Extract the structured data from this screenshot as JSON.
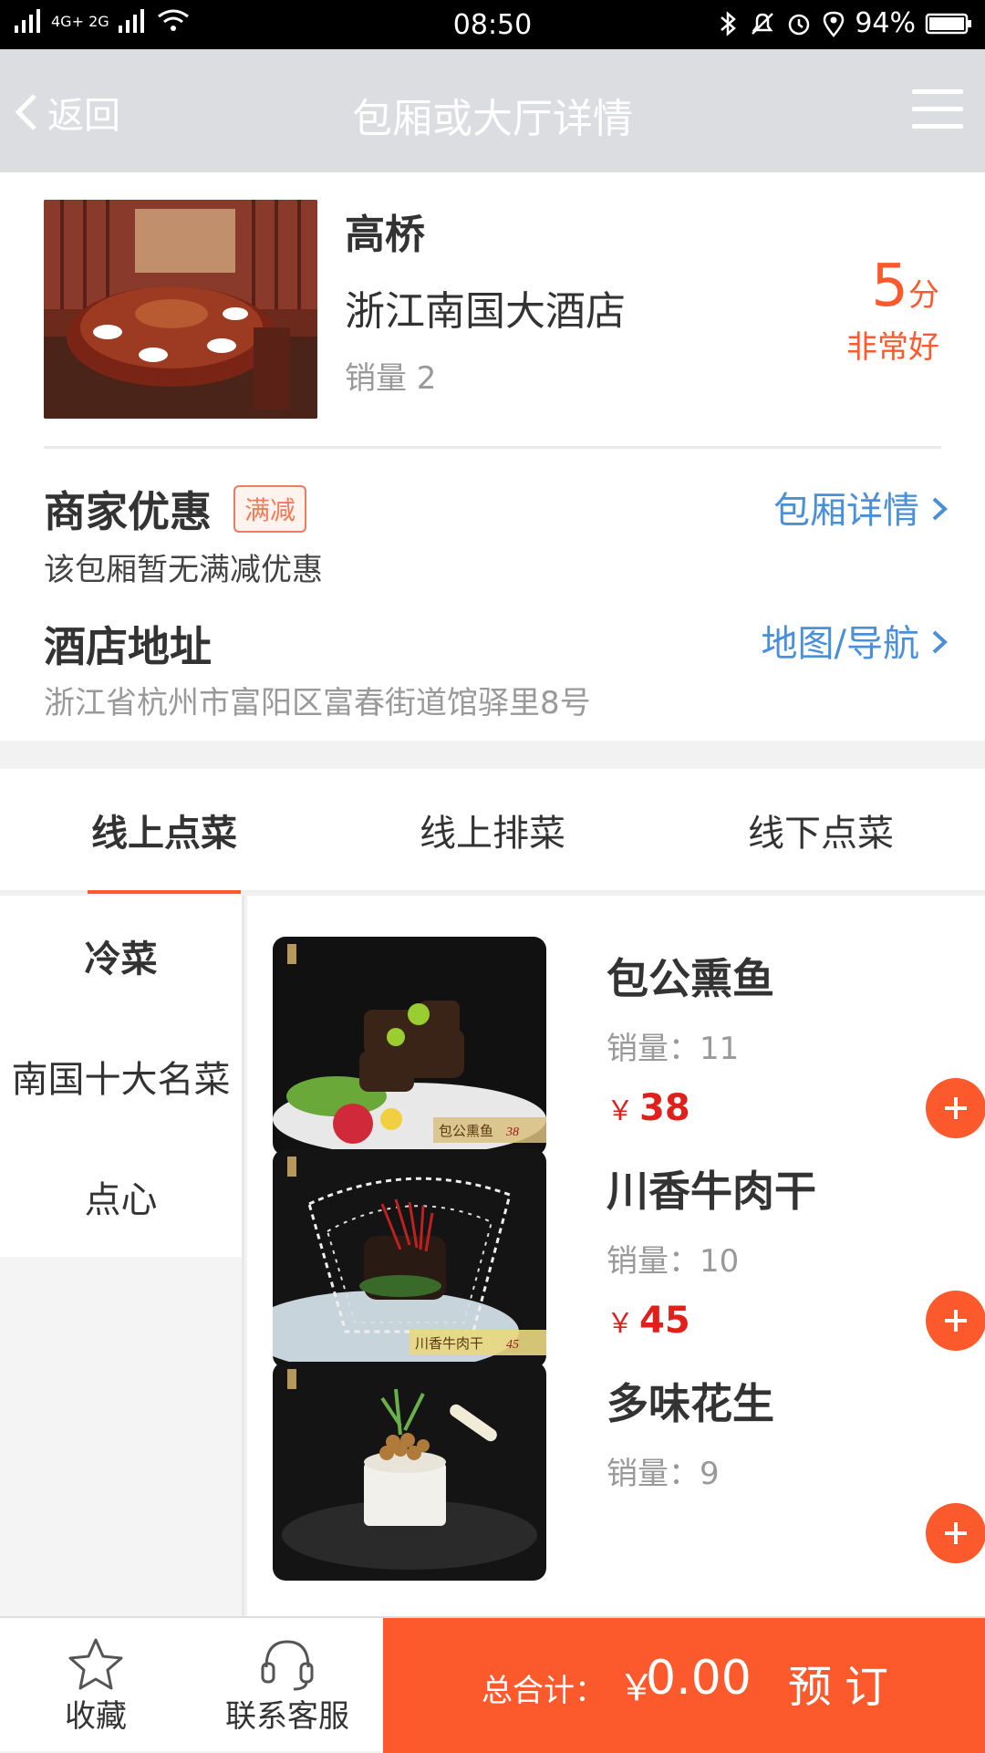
{
  "status_bar": {
    "signal_left": "2G",
    "signal_mid": "4G+ 2G",
    "time": "08:50",
    "battery": "94%"
  },
  "header": {
    "back_label": "返回",
    "title": "包厢或大厅详情"
  },
  "venue": {
    "hall_name": "高桥",
    "hotel_name": "浙江南国大酒店",
    "sales": "销量 2",
    "score": "5",
    "score_unit": "分",
    "rating_word": "非常好"
  },
  "promo": {
    "title": "商家优惠",
    "tag": "满减",
    "link": "包厢详情",
    "text": "该包厢暂无满减优惠"
  },
  "address": {
    "title": "酒店地址",
    "link": "地图/导航",
    "text": "浙江省杭州市富阳区富春街道馆驿里8号"
  },
  "tabs": [
    {
      "label": "线上点菜",
      "active": true
    },
    {
      "label": "线上排菜",
      "active": false
    },
    {
      "label": "线下点菜",
      "active": false
    }
  ],
  "categories": [
    {
      "label": "冷菜",
      "active": true
    },
    {
      "label": "南国十大名菜",
      "active": false
    },
    {
      "label": "点心",
      "active": false
    }
  ],
  "dishes": [
    {
      "name": "包公熏鱼",
      "sales": "销量：11",
      "currency": "￥",
      "price": "38",
      "img_caption": "包公熏鱼",
      "img_price": "38"
    },
    {
      "name": "川香牛肉干",
      "sales": "销量：10",
      "currency": "￥",
      "price": "45",
      "img_caption": "川香牛肉干",
      "img_price": "45"
    },
    {
      "name": "多味花生",
      "sales": "销量：9",
      "currency": "￥",
      "price": "",
      "img_caption": "",
      "img_price": ""
    }
  ],
  "bottom_bar": {
    "favorite_label": "收藏",
    "service_label": "联系客服",
    "total_label": "总合计：",
    "total_currency": "￥",
    "total_value": "0.00",
    "book_label": "预订"
  },
  "colors": {
    "accent": "#fc5a2c",
    "header_bg": "#dcdde0",
    "link": "#4a90d9",
    "price": "#e0201a"
  }
}
